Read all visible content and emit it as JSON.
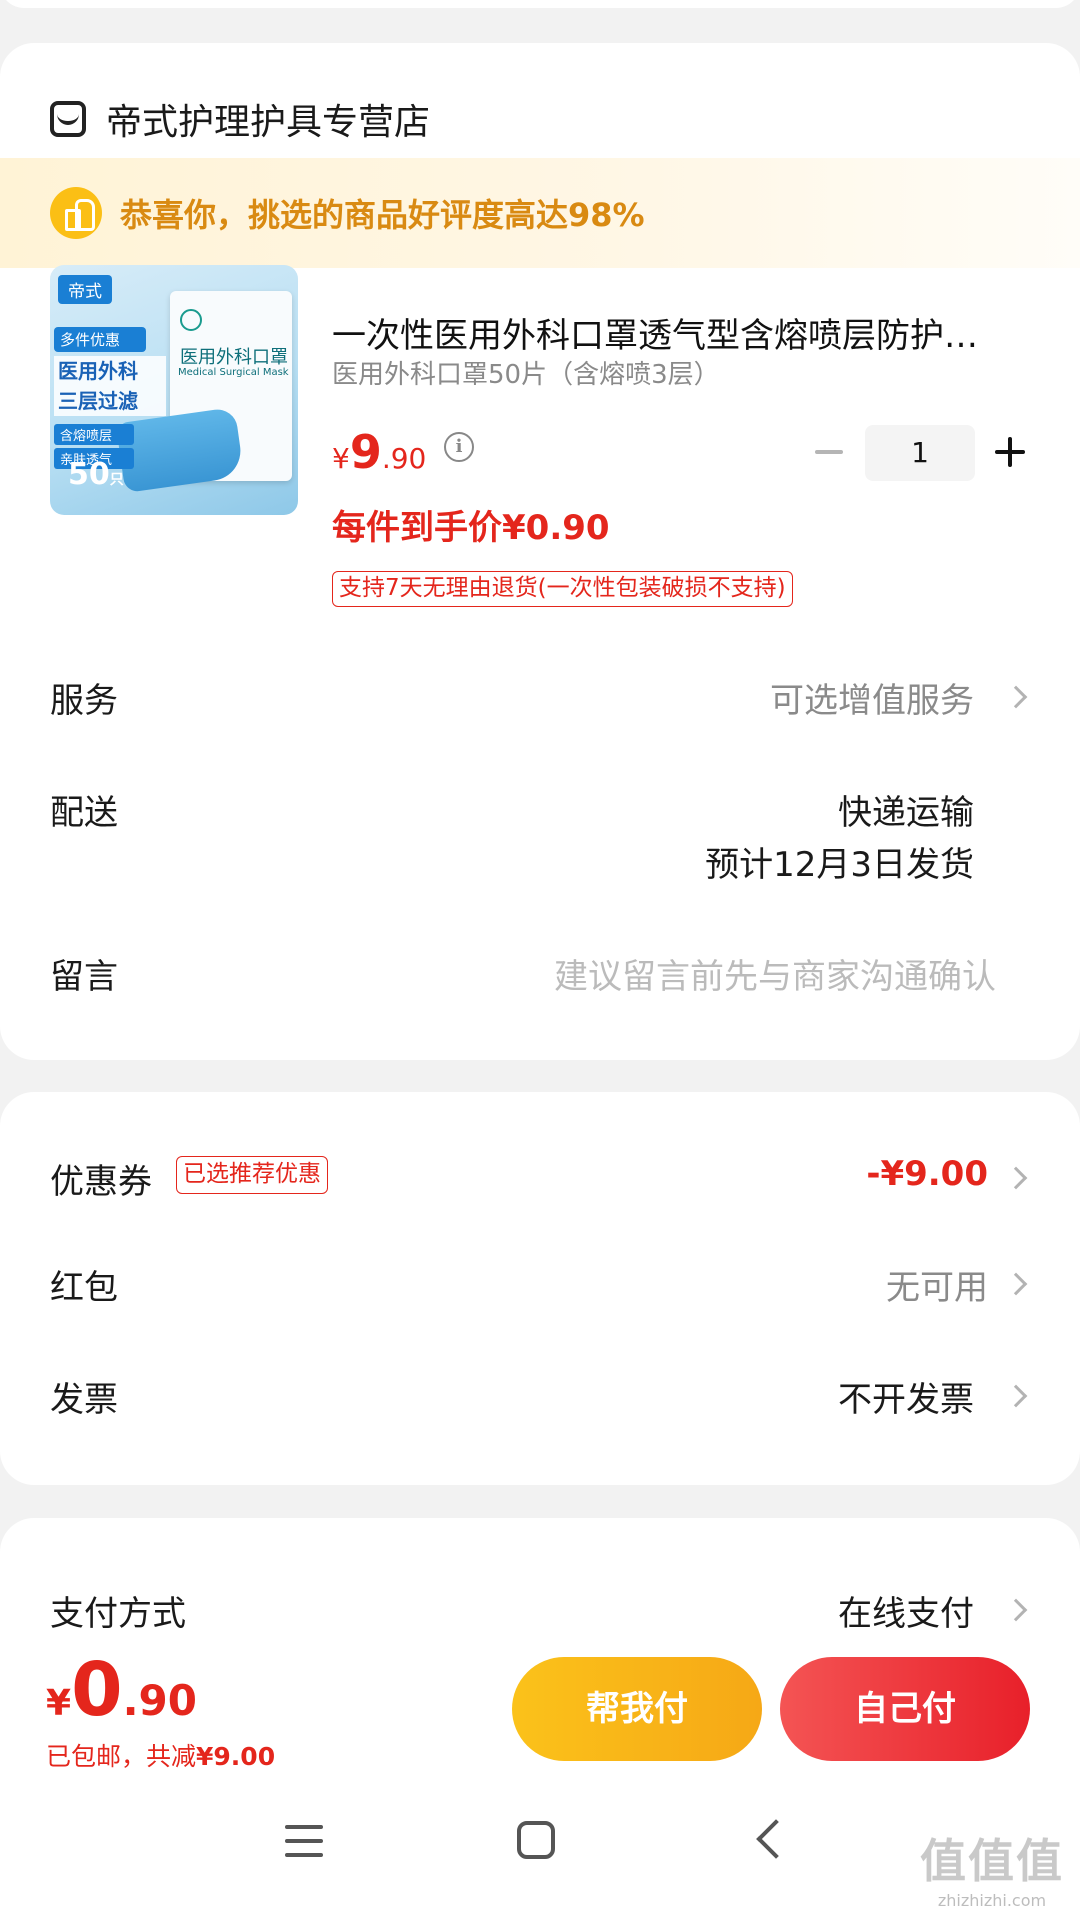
{
  "shop": {
    "name": "帝式护理护具专营店",
    "icon": "store-icon"
  },
  "praise": {
    "text": "恭喜你，挑选的商品好评度高达98%",
    "icon": "thumbs-up-icon"
  },
  "product": {
    "image": {
      "tag": "帝式",
      "badge": "多件优惠",
      "headline_1": "医用外科",
      "headline_2": "三层过滤",
      "feature_1": "含熔喷层",
      "feature_2": "亲肤透气",
      "count": "50",
      "count_unit": "只",
      "package_title": "医用外科口罩",
      "package_en": "Medical Surgical Mask"
    },
    "title": "一次性医用外科口罩透气型含熔喷层防护…",
    "spec": "医用外科口罩50片（含熔喷3层）",
    "price": {
      "symbol": "¥",
      "integer": "9",
      "decimal": ".90"
    },
    "quantity": "1",
    "unit_price": "每件到手价¥0.90",
    "return_policy": "支持7天无理由退货(一次性包装破损不支持)"
  },
  "rows": {
    "service": {
      "label": "服务",
      "value": "可选增值服务"
    },
    "delivery": {
      "label": "配送",
      "value_1": "快递运输",
      "value_2": "预计12月3日发货"
    },
    "message": {
      "label": "留言",
      "placeholder": "建议留言前先与商家沟通确认"
    },
    "coupon": {
      "label": "优惠券",
      "tag": "已选推荐优惠",
      "value": "-¥9.00"
    },
    "red_packet": {
      "label": "红包",
      "value": "无可用"
    },
    "invoice": {
      "label": "发票",
      "value": "不开发票"
    },
    "payment": {
      "label": "支付方式",
      "value": "在线支付"
    }
  },
  "footer": {
    "total": {
      "symbol": "¥",
      "integer": "0",
      "decimal": ".90"
    },
    "shipping_note": "已包邮，共减",
    "saved_amount": "¥9.00",
    "help_pay_label": "帮我付",
    "self_pay_label": "自己付"
  },
  "watermark": {
    "big": "值值值",
    "small": "zhizhizhi.com"
  },
  "colors": {
    "price_red": "#e4261c",
    "help_btn": "#fbc21a",
    "self_btn": "#e8202a",
    "praise_text": "#d98a12"
  }
}
